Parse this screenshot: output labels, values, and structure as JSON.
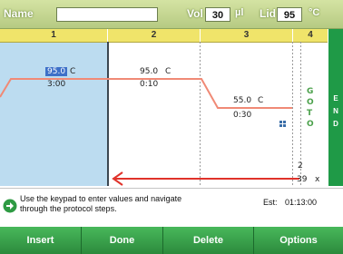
{
  "header": {
    "name_label": "Name",
    "name_value": "",
    "vol_label": "Vol",
    "vol_value": "30",
    "vol_unit": "µl",
    "lid_label": "Lid",
    "lid_value": "95",
    "lid_unit": "°C"
  },
  "steps": [
    {
      "number": "1",
      "temp": "95.0",
      "temp_unit": "C",
      "time": "3:00"
    },
    {
      "number": "2",
      "temp": "95.0",
      "temp_unit": "C",
      "time": "0:10"
    },
    {
      "number": "3",
      "temp": "55.0",
      "temp_unit": "C",
      "time": "0:30"
    },
    {
      "number": "4",
      "goto": [
        "G",
        "O",
        "T",
        "O"
      ],
      "goto_step": "2",
      "repeat": "39",
      "repeat_suffix": "x"
    }
  ],
  "end_label": [
    "E",
    "N",
    "D"
  ],
  "message": {
    "line1": "Use the keypad to enter values and navigate",
    "line2": "through the protocol steps.",
    "est_label": "Est:",
    "est_value": "01:13:00"
  },
  "toolbar": {
    "insert": "Insert",
    "done": "Done",
    "delete": "Delete",
    "options": "Options"
  },
  "colors": {
    "header": "#c4d68f",
    "step_header": "#f0e46a",
    "selected_step": "#bcdcf0",
    "trace": "#f08a76",
    "loop_arrow": "#e0322a",
    "toolbar": "#2e9a43",
    "end_bar": "#1f9a47"
  }
}
